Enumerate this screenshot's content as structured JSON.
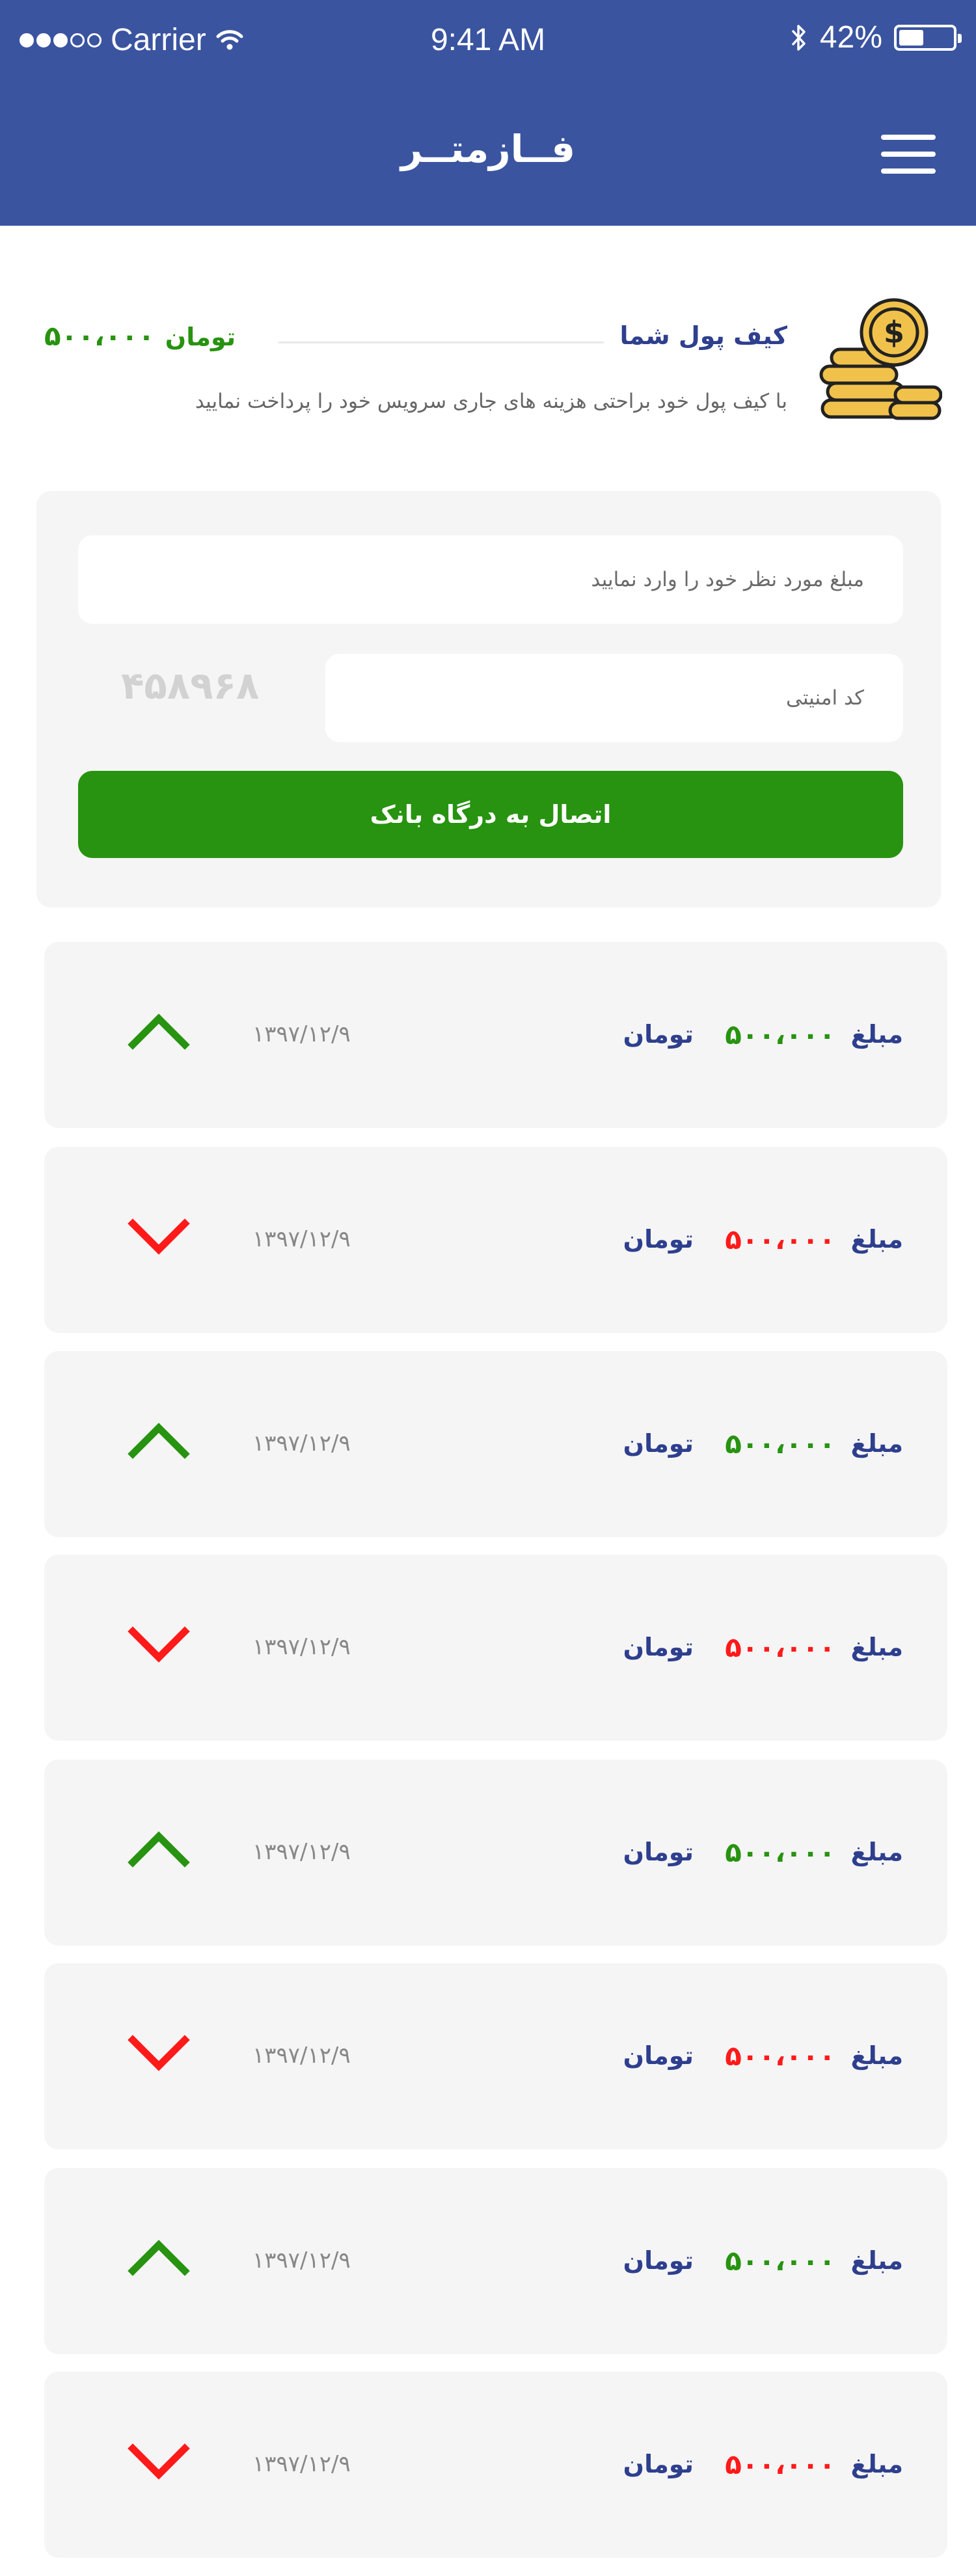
{
  "status_bar": {
    "carrier": "Carrier",
    "time": "9:41 AM",
    "battery": "42%",
    "battery_level": 0.42,
    "signal_bars_filled": 3,
    "signal_bars_total": 5
  },
  "header": {
    "title": "فــازمتــر",
    "menu_icon": "hamburger-menu-icon"
  },
  "wallet": {
    "icon": "coins-stack-icon",
    "title": "کیف پول شما",
    "balance": "۵۰۰،۰۰۰",
    "currency": "تومان",
    "description": "با کیف پول خود براحتی هزینه های جاری سرویس خود را پرداخت نمایید"
  },
  "payment": {
    "amount_placeholder": "مبلغ مورد نظر خود را وارد نمایید",
    "security_placeholder": "کد امنیتی",
    "captcha": "۴۵۸۹۶۸",
    "submit_label": "اتصال به درگاه بانک"
  },
  "colors": {
    "header": "#3a54a0",
    "primary_text": "#2e3f8e",
    "incoming": "#279310",
    "outgoing": "#ff1a1a",
    "card": "#f5f5f5"
  },
  "transactions": [
    {
      "label": "مبلغ",
      "amount": "۵۰۰،۰۰۰",
      "currency": "تومان",
      "date": "۱۳۹۷/۱۲/۹",
      "direction": "up",
      "icon": "chevron-up-icon"
    },
    {
      "label": "مبلغ",
      "amount": "۵۰۰،۰۰۰",
      "currency": "تومان",
      "date": "۱۳۹۷/۱۲/۹",
      "direction": "down",
      "icon": "chevron-down-icon"
    },
    {
      "label": "مبلغ",
      "amount": "۵۰۰،۰۰۰",
      "currency": "تومان",
      "date": "۱۳۹۷/۱۲/۹",
      "direction": "up",
      "icon": "chevron-up-icon"
    },
    {
      "label": "مبلغ",
      "amount": "۵۰۰،۰۰۰",
      "currency": "تومان",
      "date": "۱۳۹۷/۱۲/۹",
      "direction": "down",
      "icon": "chevron-down-icon"
    },
    {
      "label": "مبلغ",
      "amount": "۵۰۰،۰۰۰",
      "currency": "تومان",
      "date": "۱۳۹۷/۱۲/۹",
      "direction": "up",
      "icon": "chevron-up-icon"
    },
    {
      "label": "مبلغ",
      "amount": "۵۰۰،۰۰۰",
      "currency": "تومان",
      "date": "۱۳۹۷/۱۲/۹",
      "direction": "down",
      "icon": "chevron-down-icon"
    },
    {
      "label": "مبلغ",
      "amount": "۵۰۰،۰۰۰",
      "currency": "تومان",
      "date": "۱۳۹۷/۱۲/۹",
      "direction": "up",
      "icon": "chevron-up-icon"
    },
    {
      "label": "مبلغ",
      "amount": "۵۰۰،۰۰۰",
      "currency": "تومان",
      "date": "۱۳۹۷/۱۲/۹",
      "direction": "down",
      "icon": "chevron-down-icon"
    }
  ]
}
